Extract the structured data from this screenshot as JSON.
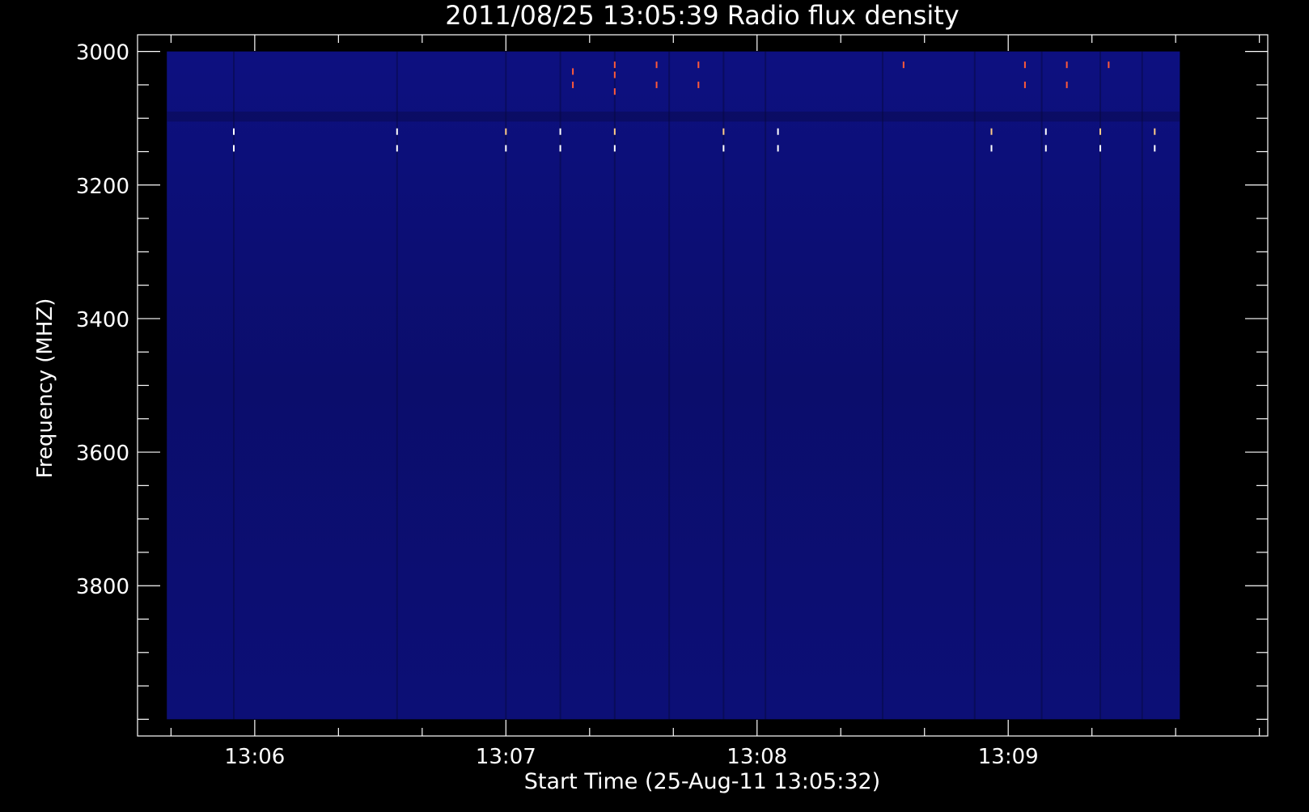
{
  "chart_data": {
    "type": "heatmap",
    "title": "2011/08/25 13:05:39 Radio flux density",
    "xlabel": "Start Time (25-Aug-11 13:05:32)",
    "ylabel": "Frequency (MHZ)",
    "x_range_seconds": [
      0,
      270
    ],
    "y_range_mhz": [
      2975,
      4025
    ],
    "data_x_range_seconds": [
      7,
      249
    ],
    "data_y_range_mhz": [
      3000,
      4000
    ],
    "x_major_ticks": [
      {
        "t": 28,
        "label": "13:06"
      },
      {
        "t": 88,
        "label": "13:07"
      },
      {
        "t": 148,
        "label": "13:08"
      },
      {
        "t": 208,
        "label": "13:09"
      }
    ],
    "x_minor_step_seconds": 20,
    "y_major_ticks": [
      {
        "f": 3000,
        "label": "3000"
      },
      {
        "f": 3200,
        "label": "3200"
      },
      {
        "f": 3400,
        "label": "3400"
      },
      {
        "f": 3600,
        "label": "3600"
      },
      {
        "f": 3800,
        "label": "3800"
      }
    ],
    "y_minor_step_mhz": 50,
    "colors": {
      "background": "#0c0e6e",
      "band_dark": "#0a0a55",
      "axis": "#ffffff",
      "burst_hot": "#ff5a3a",
      "burst_white": "#ffffff"
    },
    "dark_columns_seconds": [
      23,
      62,
      88,
      101,
      114,
      127,
      140,
      150,
      178,
      200,
      216,
      230,
      240
    ],
    "spikes": [
      {
        "t": 23,
        "f": 3120,
        "color": "#ffffff"
      },
      {
        "t": 23,
        "f": 3145,
        "color": "#ffffff"
      },
      {
        "t": 62,
        "f": 3120,
        "color": "#ffffff"
      },
      {
        "t": 62,
        "f": 3145,
        "color": "#ffffff"
      },
      {
        "t": 88,
        "f": 3120,
        "color": "#ffcc88"
      },
      {
        "t": 88,
        "f": 3145,
        "color": "#ffffff"
      },
      {
        "t": 101,
        "f": 3120,
        "color": "#ffffff"
      },
      {
        "t": 101,
        "f": 3145,
        "color": "#ffffff"
      },
      {
        "t": 114,
        "f": 3120,
        "color": "#ffcc88"
      },
      {
        "t": 114,
        "f": 3145,
        "color": "#ffffff"
      },
      {
        "t": 140,
        "f": 3120,
        "color": "#ffcc88"
      },
      {
        "t": 140,
        "f": 3145,
        "color": "#ffffff"
      },
      {
        "t": 153,
        "f": 3120,
        "color": "#ffffff"
      },
      {
        "t": 153,
        "f": 3145,
        "color": "#ffffff"
      },
      {
        "t": 204,
        "f": 3120,
        "color": "#ffcc88"
      },
      {
        "t": 204,
        "f": 3145,
        "color": "#ffffff"
      },
      {
        "t": 217,
        "f": 3120,
        "color": "#ffffff"
      },
      {
        "t": 217,
        "f": 3145,
        "color": "#ffffff"
      },
      {
        "t": 230,
        "f": 3120,
        "color": "#ffcc88"
      },
      {
        "t": 230,
        "f": 3145,
        "color": "#ffffff"
      },
      {
        "t": 243,
        "f": 3120,
        "color": "#ffcc88"
      },
      {
        "t": 243,
        "f": 3145,
        "color": "#ffffff"
      },
      {
        "t": 104,
        "f": 3030,
        "color": "#ff5a3a"
      },
      {
        "t": 104,
        "f": 3050,
        "color": "#ff5a3a"
      },
      {
        "t": 114,
        "f": 3020,
        "color": "#ff5a3a"
      },
      {
        "t": 114,
        "f": 3035,
        "color": "#ff5a3a"
      },
      {
        "t": 114,
        "f": 3060,
        "color": "#ff5a3a"
      },
      {
        "t": 124,
        "f": 3020,
        "color": "#ff5a3a"
      },
      {
        "t": 124,
        "f": 3050,
        "color": "#ff5a3a"
      },
      {
        "t": 134,
        "f": 3020,
        "color": "#ff5a3a"
      },
      {
        "t": 134,
        "f": 3050,
        "color": "#ff5a3a"
      },
      {
        "t": 183,
        "f": 3020,
        "color": "#ff5a3a"
      },
      {
        "t": 212,
        "f": 3020,
        "color": "#ff5a3a"
      },
      {
        "t": 212,
        "f": 3050,
        "color": "#ff5a3a"
      },
      {
        "t": 222,
        "f": 3020,
        "color": "#ff5a3a"
      },
      {
        "t": 222,
        "f": 3050,
        "color": "#ff5a3a"
      },
      {
        "t": 232,
        "f": 3020,
        "color": "#ff5a3a"
      }
    ]
  }
}
